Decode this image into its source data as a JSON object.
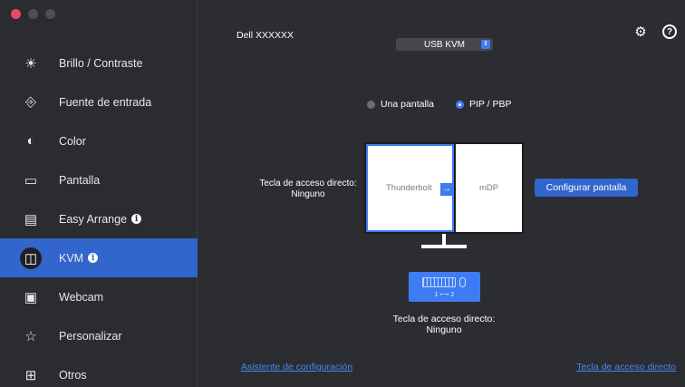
{
  "window": {
    "traffic_lights": [
      "close",
      "minimize",
      "maximize"
    ]
  },
  "sidebar": {
    "items": [
      {
        "label": "Brillo / Contraste",
        "icon": "brightness-icon",
        "glyph": "☀",
        "info": false
      },
      {
        "label": "Fuente de entrada",
        "icon": "input-source-icon",
        "glyph": "⎆",
        "info": false
      },
      {
        "label": "Color",
        "icon": "color-palette-icon",
        "glyph": "◐",
        "info": false
      },
      {
        "label": "Pantalla",
        "icon": "display-icon",
        "glyph": "▭",
        "info": false
      },
      {
        "label": "Easy Arrange",
        "icon": "easy-arrange-icon",
        "glyph": "▤",
        "info": true
      },
      {
        "label": "KVM",
        "icon": "kvm-icon",
        "glyph": "◫",
        "info": true
      },
      {
        "label": "Webcam",
        "icon": "webcam-icon",
        "glyph": "▣",
        "info": false
      },
      {
        "label": "Personalizar",
        "icon": "star-icon",
        "glyph": "☆",
        "info": false
      },
      {
        "label": "Otros",
        "icon": "others-icon",
        "glyph": "⊞",
        "info": false
      }
    ],
    "active_index": 5
  },
  "header": {
    "monitor_name": "Dell XXXXXX",
    "kvm_select_value": "USB KVM"
  },
  "mode": {
    "option_single": "Una pantalla",
    "option_pip": "PIP / PBP",
    "selected": "PIP / PBP"
  },
  "layout": {
    "hotkey_left": "Tecla de acceso directo: Ninguno",
    "screen_left_label": "Thunderbolt",
    "screen_right_label": "mDP",
    "configure_button": "Configurar pantalla"
  },
  "kvm": {
    "keyboard_label": "1 ⟷ 2",
    "hotkey_bottom": "Tecla de acceso directo: Ninguno"
  },
  "footer": {
    "setup_wizard_link": "Asistente de configuración",
    "hotkey_link": "Tecla de acceso directo"
  },
  "colors": {
    "accent": "#3366cc",
    "accent_bright": "#3f7bf2",
    "background": "#2b2d31",
    "close_dot": "#e84a5f"
  }
}
